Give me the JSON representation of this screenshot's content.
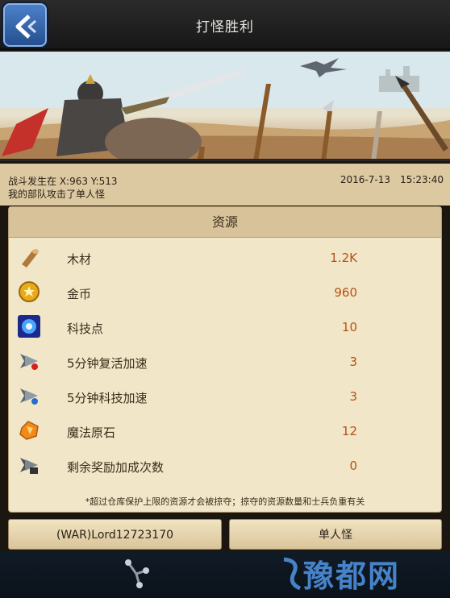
{
  "header": {
    "title": "打怪胜利"
  },
  "info": {
    "location": "战斗发生在 X:963 Y:513",
    "description": "我的部队攻击了单人怪",
    "date": "2016-7-13",
    "time": "15:23:40"
  },
  "resources": {
    "heading": "资源",
    "items": [
      {
        "label": "木材",
        "value": "1.2K",
        "icon": "wood-log-icon"
      },
      {
        "label": "金币",
        "value": "960",
        "icon": "gold-coin-icon"
      },
      {
        "label": "科技点",
        "value": "10",
        "icon": "tech-orb-icon"
      },
      {
        "label": "5分钟复活加速",
        "value": "3",
        "icon": "revive-speedup-icon"
      },
      {
        "label": "5分钟科技加速",
        "value": "3",
        "icon": "tech-speedup-icon"
      },
      {
        "label": "魔法原石",
        "value": "12",
        "icon": "magic-stone-icon"
      },
      {
        "label": "剩余奖励加成次数",
        "value": "0",
        "icon": "bonus-count-icon"
      }
    ],
    "note": "*超过仓库保护上限的资源才会被掠夺；掠夺的资源数量和士兵负重有关"
  },
  "buttons": {
    "player": "(WAR)Lord12723170",
    "target": "单人怪"
  },
  "watermark": "豫都网",
  "colors": {
    "value_orange": "#b45214",
    "panel_bg": "#f2e6c8",
    "back_button_blue": "#3a6db6"
  }
}
